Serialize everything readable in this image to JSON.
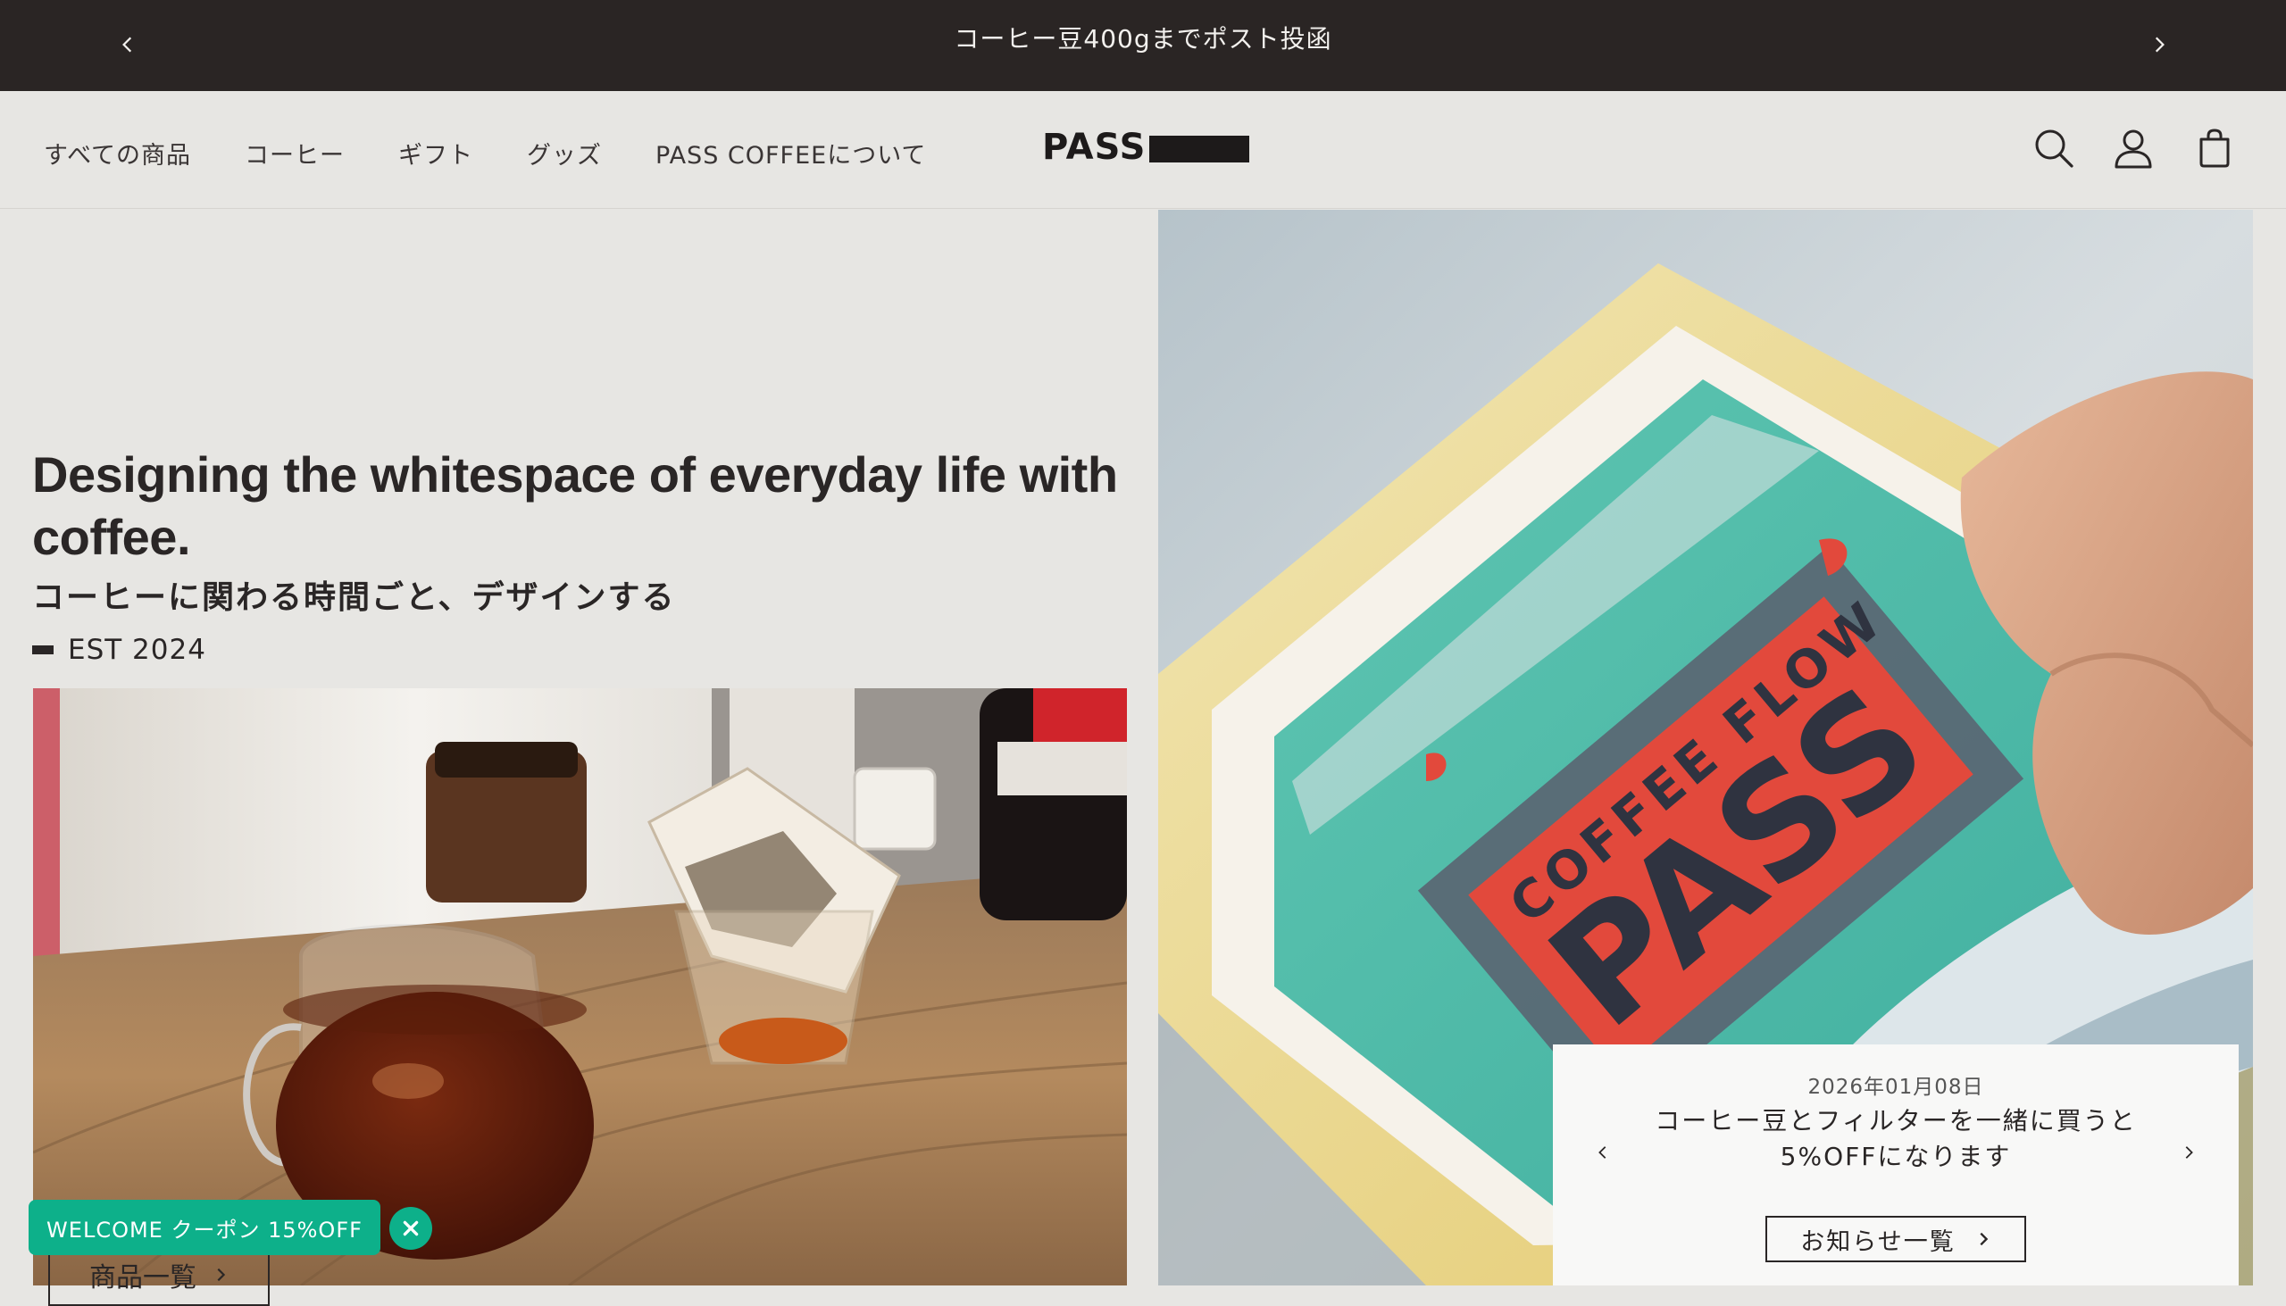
{
  "announcement": {
    "message": "コーヒー豆400gまでポスト投函",
    "prev_icon": "chevron-left-icon",
    "next_icon": "chevron-right-icon"
  },
  "header": {
    "nav": [
      {
        "label": "すべての商品"
      },
      {
        "label": "コーヒー"
      },
      {
        "label": "ギフト"
      },
      {
        "label": "グッズ"
      },
      {
        "label": "PASS COFFEEについて"
      }
    ],
    "logo_text": "PASS",
    "icons": [
      "search-icon",
      "account-icon",
      "cart-icon"
    ]
  },
  "hero": {
    "headline": "Designing the whitespace of everyday life with coffee.",
    "subhead": "コーヒーに関わる時間ごと、デザインする",
    "est": "EST 2024",
    "cta_label": "商品一覧"
  },
  "coupon": {
    "label": "WELCOME クーポン 15%OFF"
  },
  "news": {
    "date": "2026年01月08日",
    "text": "コーヒー豆とフィルターを一緒に買うと5%OFFになります",
    "button_label": "お知らせ一覧"
  },
  "colors": {
    "announce_bg": "#2a2524",
    "page_bg": "#e7e6e3",
    "coupon_green": "#0db08a",
    "text_dark": "#2a2626"
  }
}
